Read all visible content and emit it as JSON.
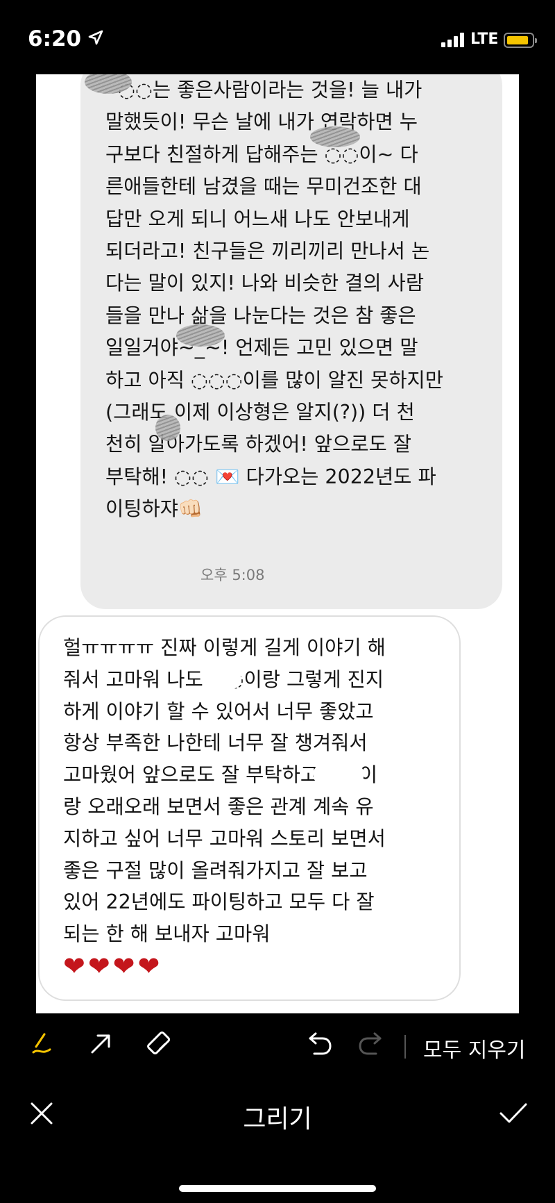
{
  "status_bar": {
    "time": "6:20",
    "network": "LTE",
    "battery_color": "#f5c400"
  },
  "chat": {
    "incoming_message": "  ◌◌는 좋은사람이라는 것을! 늘 내가\n말했듯이! 무슨 날에 내가 연락하면 누\n구보다 친절하게 답해주는 ◌◌이~ 다\n른애들한테 남겼을 때는 무미건조한 대\n답만 오게 되니 어느새 나도 안보내게\n되더라고! 친구들은 끼리끼리 만나서 논\n다는 말이 있지! 나와 비슷한 결의 사람\n들을 만나 삶을 나눈다는 것은 참 좋은\n일일거야~_~! 언제든 고민 있으면 말\n하고 아직 ◌◌◌이를 많이 알진 못하지만\n(그래도 이제 이상형은 알지(?)) 더 천\n천히 알아가도록 하겠어! 앞으로도 잘\n부탁해! ◌◌ 💌 다가오는 2022년도 파\n이팅하쟈👊🏻",
    "timestamp": "오후 5:08",
    "outgoing_message": "헐ㅠㅠㅠㅠ 진짜 이렇게 길게 이야기 해\n줘서 고마워 나도 ◌◌이랑 그렇게 진지\n하게 이야기 할 수 있어서 너무 좋았고\n항상 부족한 나한테 너무 잘 챙겨줘서\n고마웠어 앞으로도 잘 부탁하고 ◌◌이\n랑 오래오래 보면서 좋은 관계 계속 유\n지하고 싶어 너무 고마워 스토리 보면서\n좋은 구절 많이 올려줘가지고 잘 보고\n있어 22년에도 파이팅하고 모두 다 잘\n되는 한 해 보내자 고마워",
    "hearts": "❤❤❤❤"
  },
  "toolbar": {
    "pen_icon": "pen-icon",
    "arrow_icon": "arrow-icon",
    "eraser_icon": "eraser-icon",
    "undo_icon": "undo-icon",
    "redo_icon": "redo-icon",
    "clear_all_label": "모두 지우기",
    "pen_color": "#f5c400"
  },
  "bottom_bar": {
    "close_icon": "close-icon",
    "title": "그리기",
    "done_icon": "checkmark-icon"
  }
}
